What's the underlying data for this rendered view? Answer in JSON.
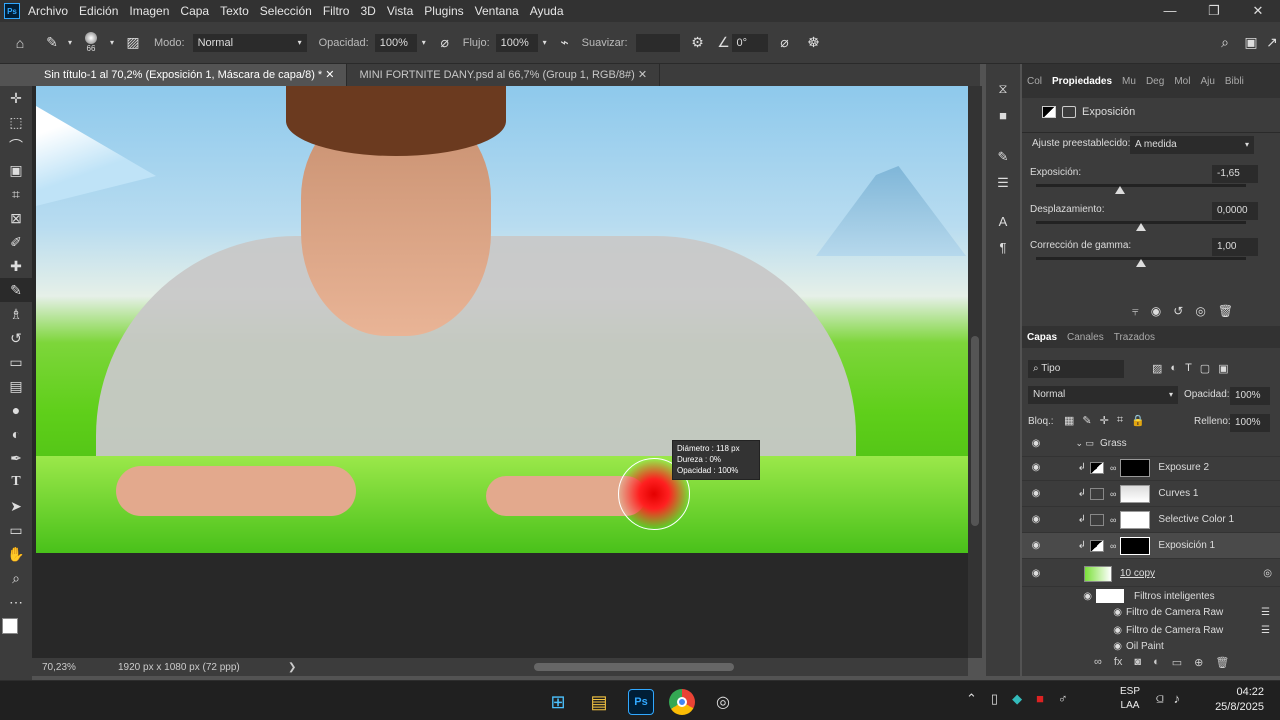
{
  "menu": [
    "Archivo",
    "Edición",
    "Imagen",
    "Capa",
    "Texto",
    "Selección",
    "Filtro",
    "3D",
    "Vista",
    "Plugins",
    "Ventana",
    "Ayuda"
  ],
  "app_icon": "Ps",
  "options": {
    "brush_size": "66",
    "mode_label": "Modo:",
    "mode_value": "Normal",
    "opacity_label": "Opacidad:",
    "opacity_value": "100%",
    "flow_label": "Flujo:",
    "flow_value": "100%",
    "smooth_label": "Suavizar:",
    "angle_value": "0°"
  },
  "tabs": [
    {
      "label": "Sin título-1 al 70,2% (Exposición 1, Máscara de capa/8) *"
    },
    {
      "label": "MINI FORTNITE DANY.psd al 66,7% (Group 1, RGB/8#)"
    }
  ],
  "brush_tip": {
    "diameter_label": "Diámetro :",
    "diameter": "118 px",
    "hardness_label": "Dureza :",
    "hardness": "0%",
    "opacity_label": "Opacidad :",
    "opacity": "100%"
  },
  "status": {
    "zoom": "70,23%",
    "doc_size": "1920 px x 1080 px (72 ppp)"
  },
  "properties": {
    "tabs": [
      "Col",
      "Propiedades",
      "Mu",
      "Deg",
      "Mol",
      "Aju",
      "Bibli"
    ],
    "title": "Exposición",
    "preset_label": "Ajuste preestablecido:",
    "preset_value": "A medida",
    "exposure_label": "Exposición:",
    "exposure_value": "-1,65",
    "exposure_pos": 0.4,
    "offset_label": "Desplazamiento:",
    "offset_value": "0,0000",
    "offset_pos": 0.5,
    "gamma_label": "Corrección de gamma:",
    "gamma_value": "1,00",
    "gamma_pos": 0.5
  },
  "layers": {
    "tabs": [
      "Capas",
      "Canales",
      "Trazados"
    ],
    "filter": "Tipo",
    "blend": "Normal",
    "opacity_label": "Opacidad:",
    "opacity_value": "100%",
    "lock_label": "Bloq.:",
    "fill_label": "Relleno:",
    "fill_value": "100%",
    "rows": [
      {
        "name": "Grass"
      },
      {
        "name": "Exposure 2"
      },
      {
        "name": "Curves 1"
      },
      {
        "name": "Selective Color 1"
      },
      {
        "name": "Exposición 1"
      },
      {
        "name": "10 copy"
      },
      {
        "name": "Filtros inteligentes"
      },
      {
        "name": "Filtro de Camera Raw"
      },
      {
        "name": "Filtro de Camera Raw"
      },
      {
        "name": "Oil Paint"
      }
    ]
  },
  "taskbar": {
    "lang1": "ESP",
    "lang2": "LAA",
    "time": "04:22",
    "date": "25/8/2025"
  }
}
